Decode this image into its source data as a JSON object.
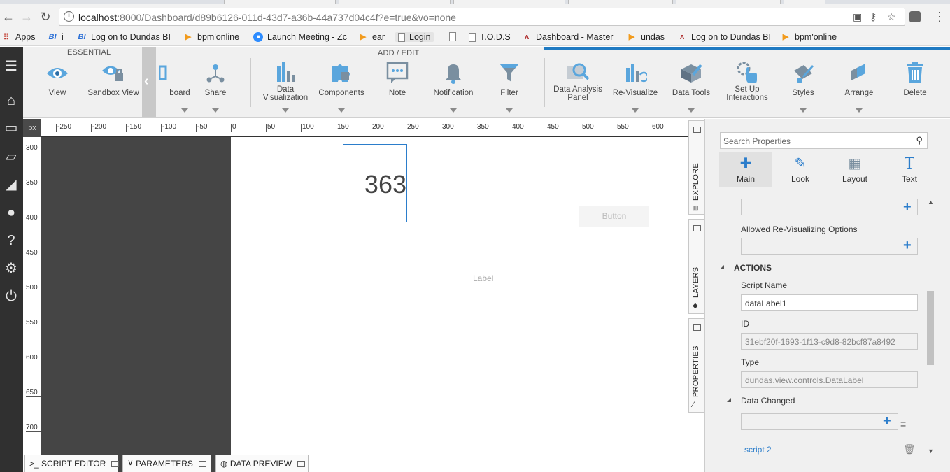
{
  "browser": {
    "url_host": "localhost",
    "url_rest": ":8000/Dashboard/d89b6126-011d-43d7-a36b-44a737d04c4f?e=true&vo=none",
    "info_glyph": "i",
    "icons": [
      "back-icon",
      "forward-icon",
      "reload-icon",
      "info-icon",
      "blocked-popup-icon",
      "key-icon",
      "star-icon",
      "extension-icon",
      "menu-icon"
    ]
  },
  "bookmarks": [
    {
      "label": "Apps",
      "icon": "apps-icon"
    },
    {
      "label": "i",
      "icon": "bi-icon"
    },
    {
      "label": "Log on to Dundas BI",
      "icon": "bi-icon"
    },
    {
      "label": "bpm'online",
      "icon": "play-icon"
    },
    {
      "label": "Launch Meeting - Zc",
      "icon": "zoom-icon"
    },
    {
      "label": "ear",
      "icon": "play-icon"
    },
    {
      "label": "Login",
      "icon": "page-icon"
    },
    {
      "label": "T.O.D.S",
      "icon": "page-icon"
    },
    {
      "label": "Dashboard - Master",
      "icon": "dundas-icon"
    },
    {
      "label": "undas",
      "icon": "play-icon"
    },
    {
      "label": "Log on to Dundas BI",
      "icon": "dundas-icon"
    },
    {
      "label": "bpm'online",
      "icon": "play-icon"
    }
  ],
  "ribbon": {
    "sections": {
      "essential": "ESSENTIAL",
      "add_edit": "ADD / EDIT"
    },
    "buttons": [
      {
        "label": "View",
        "icon": "eye-icon"
      },
      {
        "label": "Sandbox View",
        "icon": "sandbox-view-icon"
      },
      {
        "label": "board",
        "icon": "dashboard-icon"
      },
      {
        "label": "Share",
        "icon": "share-icon"
      },
      {
        "label": "Data\nVisualization",
        "icon": "data-visualization-icon"
      },
      {
        "label": "Components",
        "icon": "puzzle-icon"
      },
      {
        "label": "Note",
        "icon": "note-icon"
      },
      {
        "label": "Notification",
        "icon": "bell-icon"
      },
      {
        "label": "Filter",
        "icon": "filter-icon"
      },
      {
        "label": "Data Analysis\nPanel",
        "icon": "analysis-panel-icon"
      },
      {
        "label": "Re-Visualize",
        "icon": "revisualize-icon"
      },
      {
        "label": "Data Tools",
        "icon": "data-tools-icon"
      },
      {
        "label": "Set Up\nInteractions",
        "icon": "interactions-icon"
      },
      {
        "label": "Styles",
        "icon": "styles-icon"
      },
      {
        "label": "Arrange",
        "icon": "arrange-icon"
      },
      {
        "label": "Delete",
        "icon": "trash-icon"
      }
    ],
    "collapse_glyph": "‹"
  },
  "canvas": {
    "unit": "px",
    "ruler_x": [
      "-250",
      "-200",
      "-150",
      "-100",
      "-50",
      "0",
      "50",
      "100",
      "150",
      "200",
      "250",
      "300",
      "350",
      "400",
      "450",
      "500",
      "550",
      "600"
    ],
    "ruler_y": [
      "300",
      "350",
      "400",
      "450",
      "500",
      "550",
      "600",
      "650",
      "700"
    ],
    "data_label_value": "363",
    "button_text": "Button",
    "label_text": "Label"
  },
  "bottom_tabs": [
    "SCRIPT EDITOR",
    "PARAMETERS",
    "DATA PREVIEW"
  ],
  "side_tabs": [
    "EXPLORE",
    "LAYERS",
    "PROPERTIES"
  ],
  "properties": {
    "search_placeholder": "Search Properties",
    "tabs": [
      {
        "label": "Main",
        "icon": "puzzle-icon"
      },
      {
        "label": "Look",
        "icon": "brush-icon"
      },
      {
        "label": "Layout",
        "icon": "layout-icon"
      },
      {
        "label": "Text",
        "icon": "text-icon"
      }
    ],
    "allowed_revisualizing": "Allowed Re-Visualizing Options",
    "actions_header": "ACTIONS",
    "script_name_label": "Script Name",
    "script_name_value": "dataLabel1",
    "id_label": "ID",
    "id_value": "31ebf20f-1693-1f13-c9d8-82bcf87a8492",
    "type_label": "Type",
    "type_value": "dundas.view.controls.DataLabel",
    "data_changed_label": "Data Changed",
    "script_link": "script 2"
  }
}
